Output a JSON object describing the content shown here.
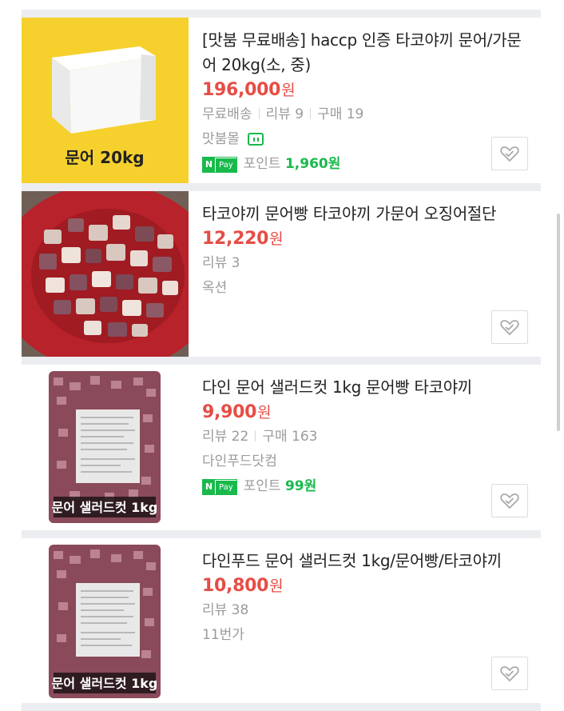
{
  "items": [
    {
      "title": "[맛붐 무료배송] haccp 인증 타코야끼 문어/가문어 20kg(소, 중)",
      "price": "196,000",
      "won": "원",
      "meta": [
        "무료배송",
        "리뷰 9",
        "구매 19"
      ],
      "mall": "맛붐몰",
      "npay_label": "Pay",
      "npay_n": "N",
      "point_label": "포인트",
      "point_value": "1,960원",
      "thumb_caption": "문어 20kg"
    },
    {
      "title": "타코야끼 문어빵 타코야끼 가문어 오징어절단",
      "price": "12,220",
      "won": "원",
      "meta": [
        "리뷰 3"
      ],
      "mall": "옥션"
    },
    {
      "title": "다인 문어 샐러드컷 1kg 문어빵 타코야끼",
      "price": "9,900",
      "won": "원",
      "meta": [
        "리뷰 22",
        "구매 163"
      ],
      "mall": "다인푸드닷컴",
      "npay_label": "Pay",
      "npay_n": "N",
      "point_label": "포인트",
      "point_value": "99원",
      "thumb_caption": "문어 샐러드컷 1kg"
    },
    {
      "title": "다인푸드 문어 샐러드컷 1kg/문어빵/타코야끼",
      "price": "10,800",
      "won": "원",
      "meta": [
        "리뷰 38"
      ],
      "mall": "11번가",
      "thumb_caption": "문어 샐러드컷 1kg"
    }
  ],
  "colors": {
    "price": "#e64d45",
    "npay_green": "#19b94c",
    "meta_gray": "#9b9b9b",
    "thumb_yellow": "#f6d12e"
  },
  "icons": {
    "zzim": "heart-check-icon",
    "talk": "talk-chat-icon",
    "npay": "naver-pay-badge"
  }
}
